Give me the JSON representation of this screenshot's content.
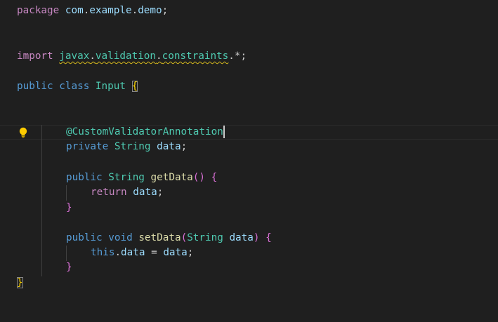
{
  "editor": {
    "language": "java",
    "colors": {
      "background": "#1f1f1f",
      "keyword": "#569cd6",
      "control_keyword": "#c586c0",
      "type": "#4ec9b0",
      "function": "#dcdcaa",
      "variable": "#9cdcfe",
      "warning_squiggle": "#d7ba1d",
      "lightbulb": "#ffcc00"
    },
    "lines": {
      "package_kw": "package",
      "package_name": "com",
      "package_name2": "example",
      "package_name3": "demo",
      "import_kw": "import",
      "import_pkg1": "javax",
      "import_pkg2": "validation",
      "import_pkg3": "constraints",
      "class_public": "public",
      "class_kw": "class",
      "class_name": "Input",
      "annotation_at": "@",
      "annotation_name": "CustomValidatorAnnotation",
      "field_private": "private",
      "field_type": "String",
      "field_name": "data",
      "getter_public": "public",
      "getter_type": "String",
      "getter_name": "getData",
      "return_kw": "return",
      "return_var": "data",
      "setter_public": "public",
      "setter_void": "void",
      "setter_name": "setData",
      "param_type": "String",
      "param_name": "data",
      "this_kw": "this",
      "this_field": "data",
      "assign_value": "data"
    },
    "icons": {
      "quick_fix": "lightbulb-icon"
    }
  }
}
